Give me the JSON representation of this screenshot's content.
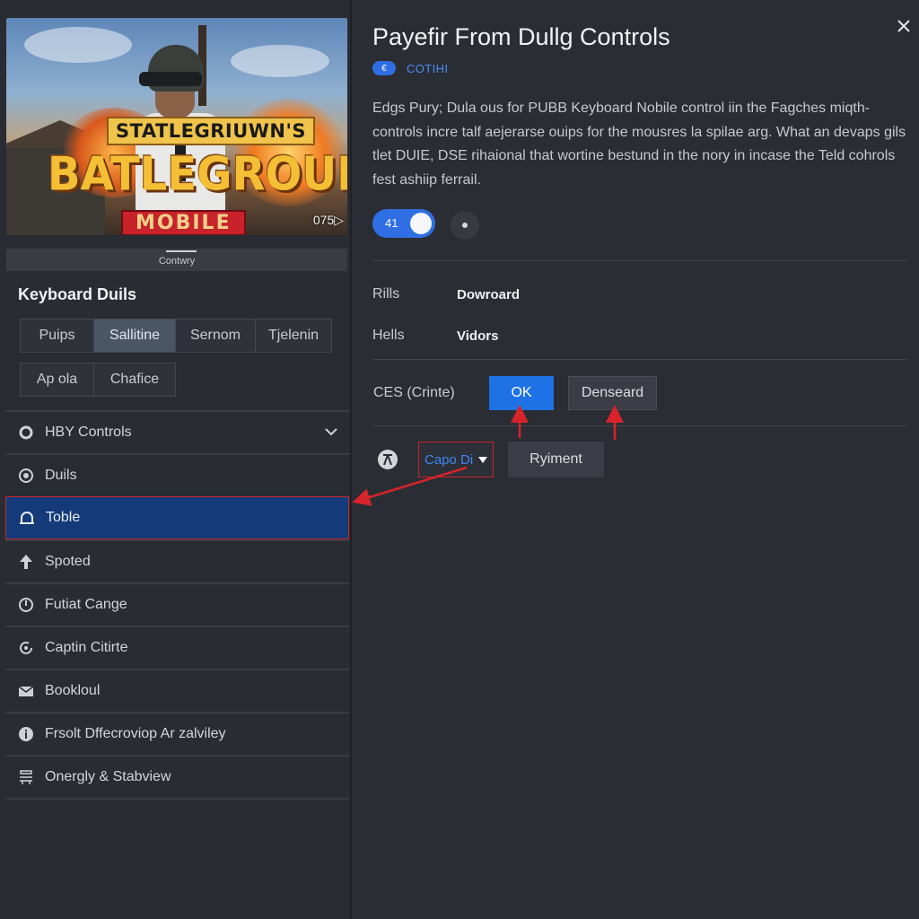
{
  "hero": {
    "logo_top": "STATLEGRIUWN'S",
    "logo_main": "BATLEGROUNDS",
    "logo_sub": "MOBILE",
    "time_badge": "075▷",
    "caption": "Contwry"
  },
  "left": {
    "section_title": "Keyboard Duils",
    "chips": [
      "Puips",
      "Sallitine",
      "Sernom",
      "Tjelenin",
      "Ap ola",
      "Chafice"
    ],
    "active_chip": "Sallitine",
    "menu": [
      {
        "label": "HBY Controls",
        "icon": "circle-icon",
        "has_chevron": true
      },
      {
        "label": "Duils",
        "icon": "target-icon"
      },
      {
        "label": "Toble",
        "icon": "arch-icon",
        "selected": true
      },
      {
        "label": "Spoted",
        "icon": "arrow-up-icon"
      },
      {
        "label": "Futiat Cange",
        "icon": "clock-icon"
      },
      {
        "label": "Captin Citirte",
        "icon": "refresh-icon"
      },
      {
        "label": "Bookloul",
        "icon": "envelope-icon"
      },
      {
        "label": "Frsolt Dffecroviop Ar zalviley",
        "icon": "info-icon"
      },
      {
        "label": "Onergly & Stabview",
        "icon": "settings-list-icon"
      }
    ]
  },
  "main": {
    "title": "Payefir From Dullg Controls",
    "tag_dot": "€",
    "tag_label": "COTIHI",
    "description": "Edgs Pury; Dula ous for PUBB Keyboard Nobile control iin the Fagches miqth-controls incre talf aejerarse ouips for the mousres la spilae arg. What an devaps gils tlet DUIE, DSE rihaional that wortine bestund in the nory in incase the Teld cohrols fest ashiip ferrail.",
    "toggle_value": "41",
    "rows": [
      {
        "label": "Rills",
        "value": "Dowroard"
      },
      {
        "label": "Hells",
        "value": "Vidors"
      }
    ],
    "ces_label": "CES (Crinte)",
    "ok_label": "OK",
    "densear_label": "Denseard",
    "select_value": "Capo Di",
    "riment_label": "Ryiment"
  },
  "colors": {
    "accent": "#1f72e6",
    "selected_bg": "#153a7a",
    "annotation_red": "#d8232a",
    "background": "#2b2d34"
  }
}
